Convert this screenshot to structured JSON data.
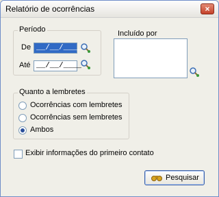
{
  "window": {
    "title": "Relatório de ocorrências",
    "close_glyph": "×"
  },
  "periodo": {
    "label": "Período",
    "de_label": "De",
    "de_value": "__/__/____",
    "ate_label": "Até",
    "ate_value": "__/__/____"
  },
  "incluido": {
    "label": "Incluído por"
  },
  "lembretes": {
    "label": "Quanto a lembretes",
    "options": [
      {
        "label": "Ocorrências com lembretes",
        "selected": false
      },
      {
        "label": "Ocorrências sem lembretes",
        "selected": false
      },
      {
        "label": "Ambos",
        "selected": true
      }
    ]
  },
  "exibir": {
    "label": "Exibir informações do primeiro contato",
    "checked": false
  },
  "pesquisar": {
    "label": "Pesquisar"
  },
  "colors": {
    "accent": "#316ac5",
    "border": "#7f9db9"
  }
}
